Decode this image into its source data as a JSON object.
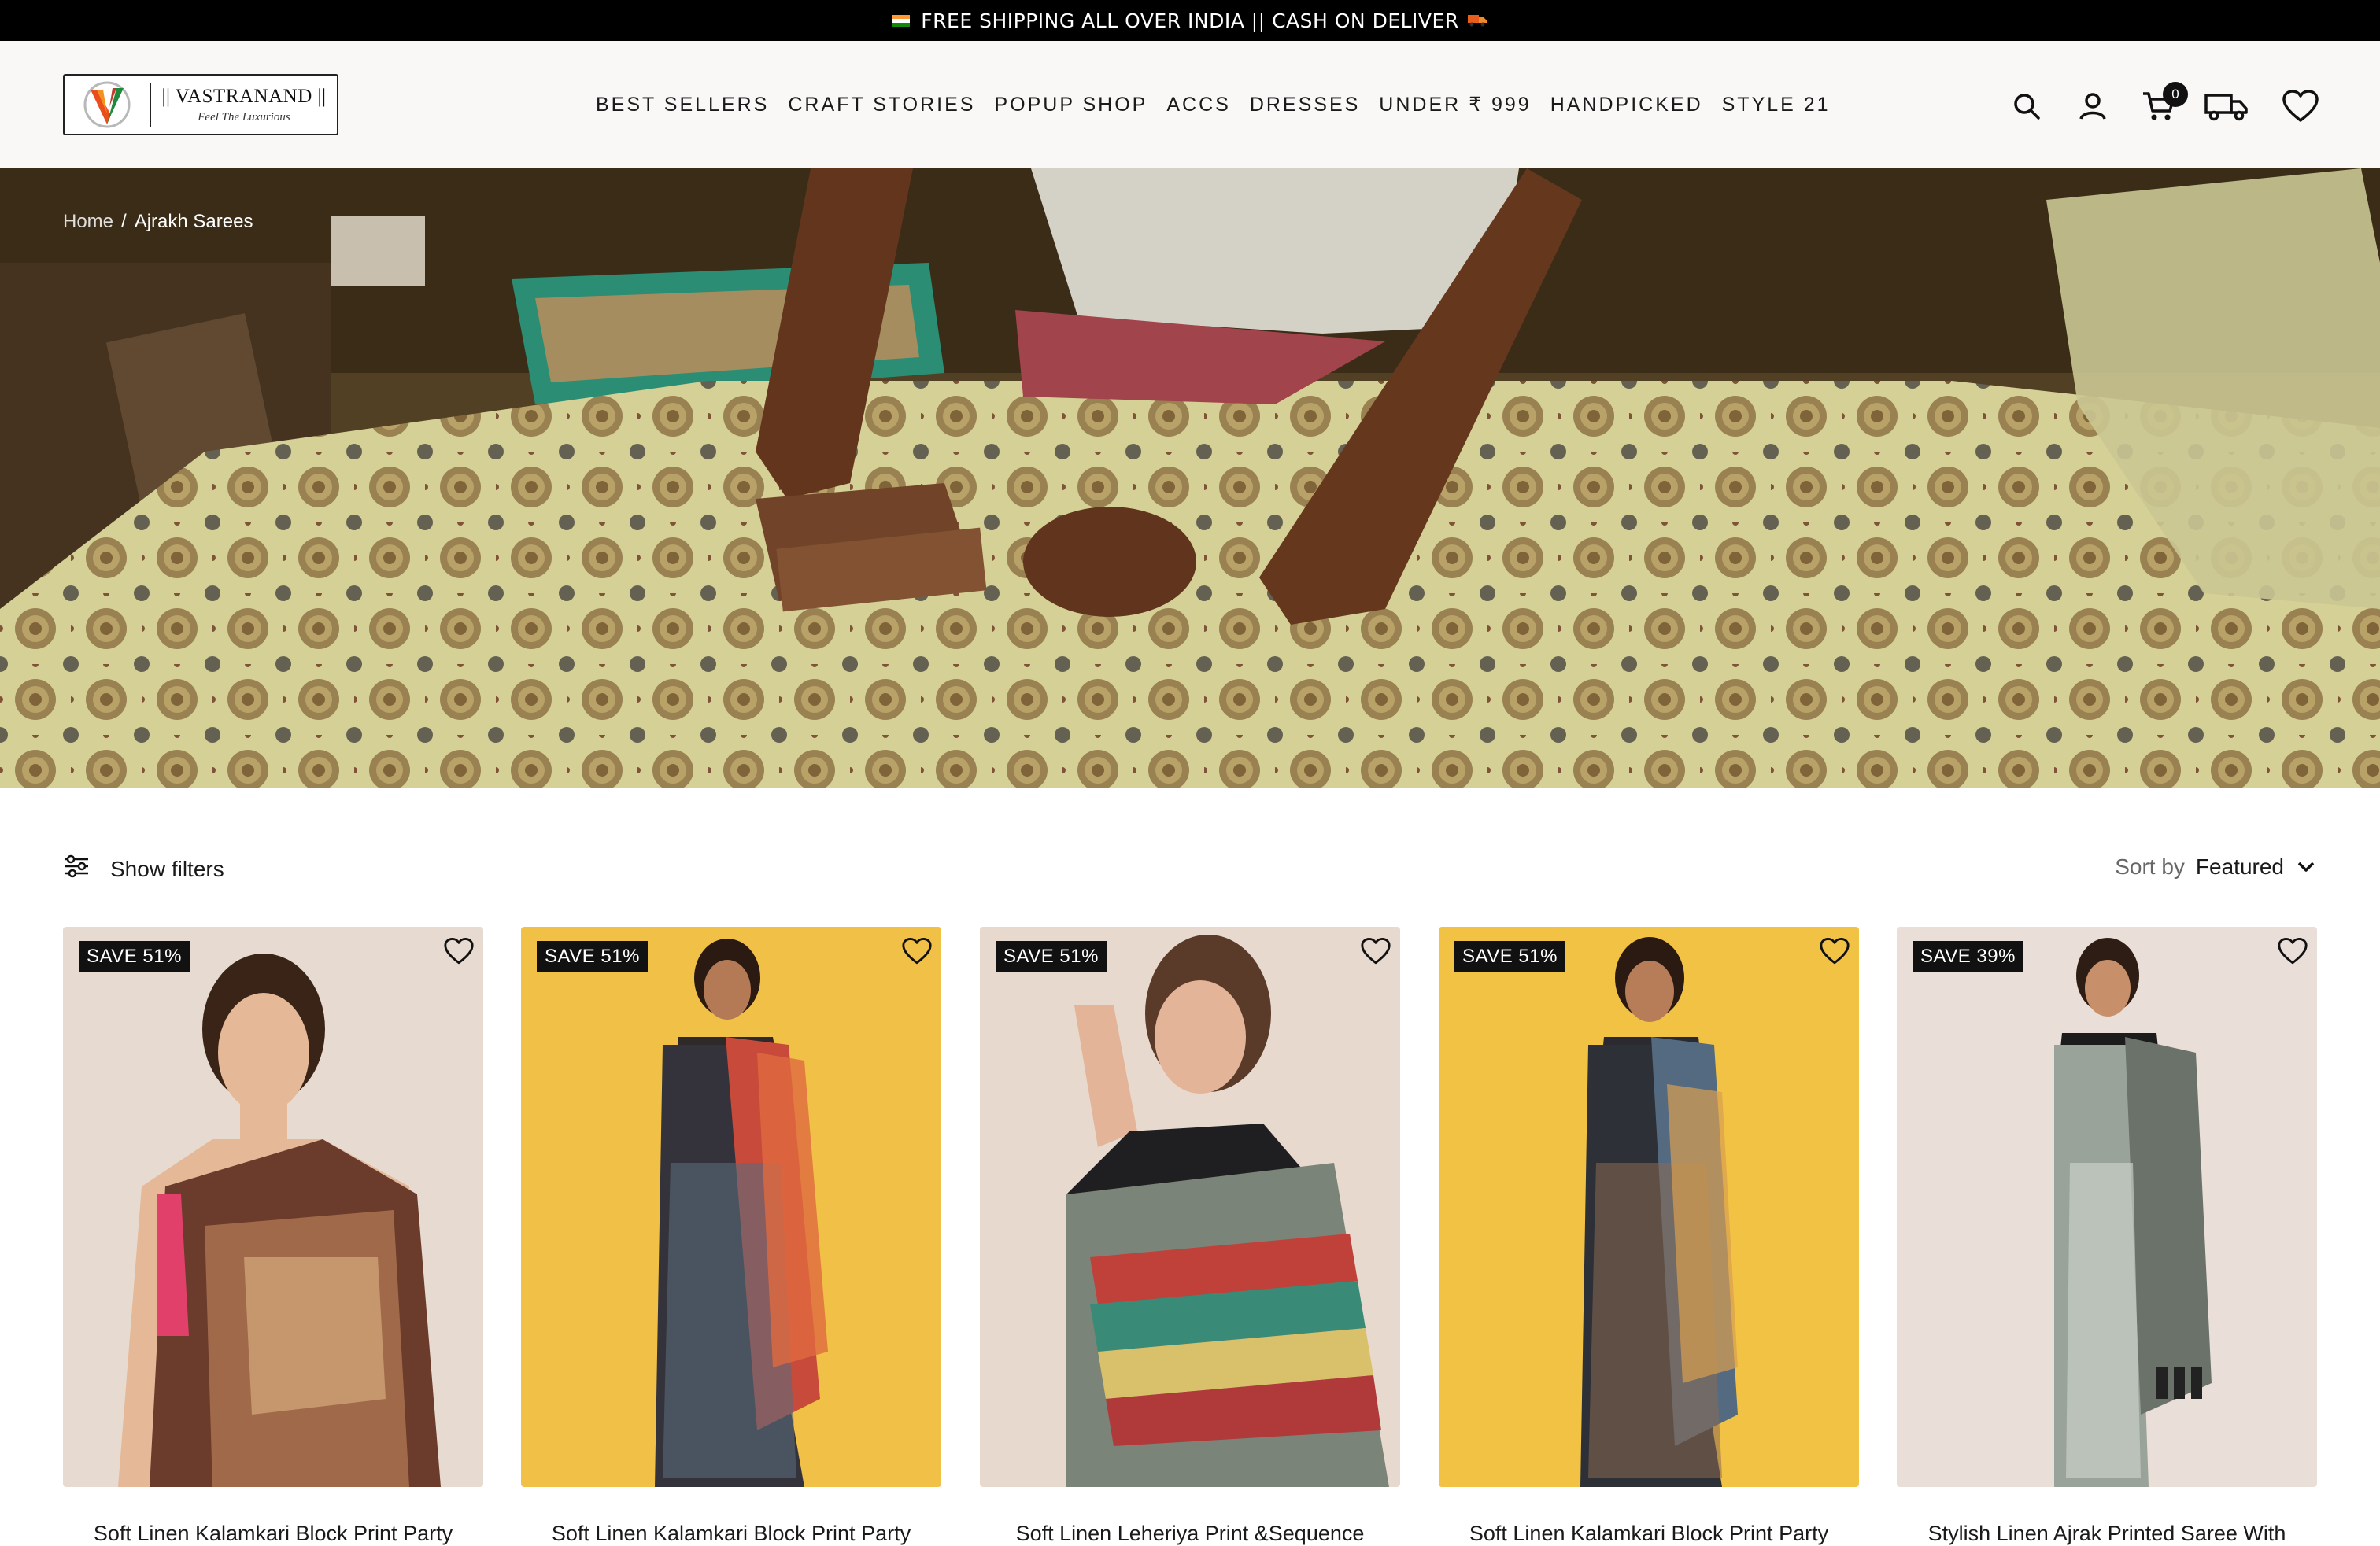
{
  "announcement": {
    "flag_icon": "india-flag-icon",
    "text": "FREE SHIPPING ALL OVER INDIA || CASH ON DELIVER",
    "truck_icon": "delivery-truck-emoji"
  },
  "header": {
    "logo": {
      "brand": "|| VASTRANAND ||",
      "tagline": "Feel The Luxurious"
    },
    "nav": [
      "BEST SELLERS",
      "CRAFT STORIES",
      "POPUP SHOP",
      "ACCS",
      "DRESSES",
      "UNDER ₹ 999",
      "HANDPICKED",
      "STYLE 21"
    ],
    "icons": [
      "search-icon",
      "account-icon",
      "cart-icon",
      "delivery-truck-icon",
      "wishlist-heart-icon"
    ],
    "cart_count": "0"
  },
  "hero": {
    "breadcrumb": {
      "home": "Home",
      "separator": "/",
      "current": "Ajrakh Sarees"
    }
  },
  "toolbar": {
    "filters_label": "Show filters",
    "sort_label": "Sort by",
    "sort_value": "Featured"
  },
  "products": [
    {
      "badge": "SAVE 51%",
      "title": "Soft Linen Kalamkari Block Print Party",
      "bg": "#e7dbd1"
    },
    {
      "badge": "SAVE 51%",
      "title": "Soft Linen Kalamkari Block Print Party",
      "bg": "#f1c046"
    },
    {
      "badge": "SAVE 51%",
      "title": "Soft Linen Leheriya Print &Sequence",
      "bg": "#e8d9cf"
    },
    {
      "badge": "SAVE 51%",
      "title": "Soft Linen Kalamkari Block Print Party",
      "bg": "#f2c244"
    },
    {
      "badge": "SAVE 39%",
      "title": "Stylish Linen Ajrak Printed Saree With",
      "bg": "#e9ded8"
    }
  ],
  "colors": {
    "announcement_bg": "#000000",
    "header_bg": "#faf8f6",
    "badge_bg": "#111111"
  }
}
